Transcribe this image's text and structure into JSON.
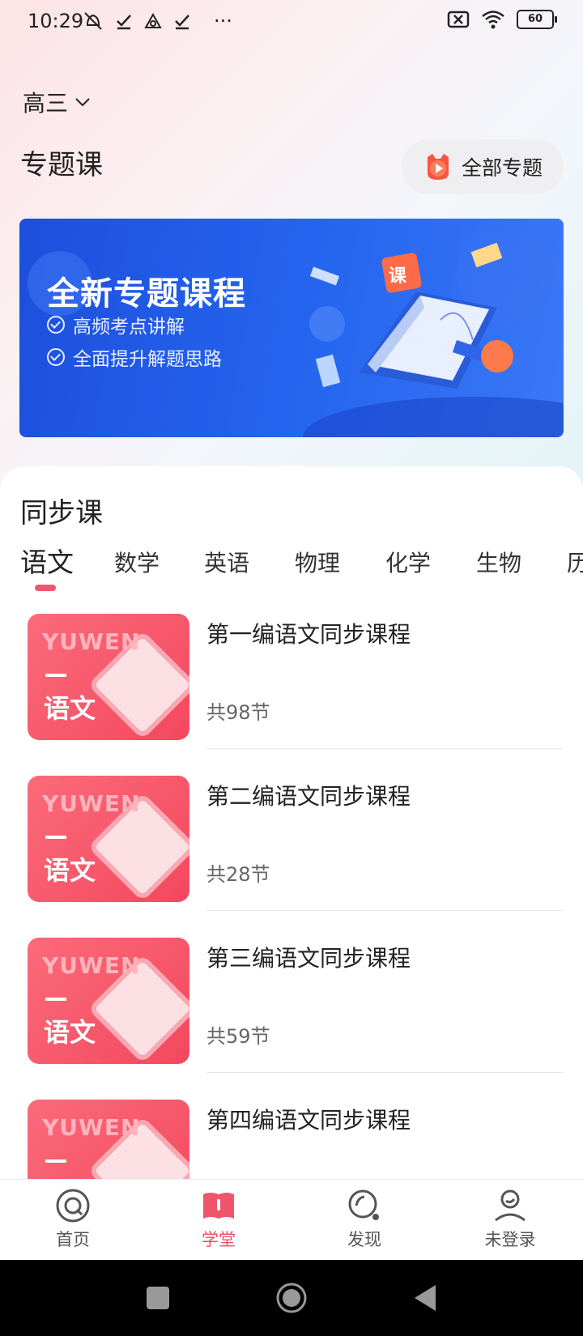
{
  "status": {
    "time": "10:29",
    "more": "···",
    "battery": "60"
  },
  "grade": {
    "label": "高三"
  },
  "topics": {
    "title": "专题课",
    "all_button": "全部专题"
  },
  "banner": {
    "title": "全新专题课程",
    "points": [
      "高频考点讲解",
      "全面提升解题思路"
    ],
    "badge": "课"
  },
  "sync": {
    "title": "同步课",
    "tabs": [
      "语文",
      "数学",
      "英语",
      "物理",
      "化学",
      "生物",
      "历"
    ],
    "active_tab": 0,
    "courses": [
      {
        "title": "第一编语文同步课程",
        "count": "共98节"
      },
      {
        "title": "第二编语文同步课程",
        "count": "共28节"
      },
      {
        "title": "第三编语文同步课程",
        "count": "共59节"
      },
      {
        "title": "第四编语文同步课程",
        "count": ""
      }
    ],
    "thumb": {
      "label_en": "YUWEN",
      "label_cn": "语文"
    }
  },
  "nav": [
    {
      "label": "首页",
      "icon": "home-icon"
    },
    {
      "label": "学堂",
      "icon": "book-icon"
    },
    {
      "label": "发现",
      "icon": "discover-icon"
    },
    {
      "label": "未登录",
      "icon": "user-icon"
    }
  ],
  "colors": {
    "accent": "#ef4e63",
    "banner": "#2566ef"
  }
}
